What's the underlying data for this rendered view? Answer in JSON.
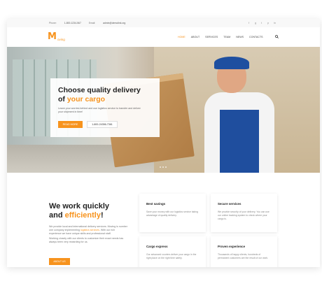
{
  "topbar": {
    "phone_label": "Phone:",
    "phone": "1-800-1234-567",
    "email_label": "Email:",
    "email": "admin@demolink.org",
    "socials": [
      "facebook-icon",
      "google-plus-icon",
      "twitter-icon",
      "pinterest-icon",
      "linkedin-icon"
    ]
  },
  "header": {
    "logo_mark": "M",
    "logo_text": "oving",
    "nav": [
      "HOME",
      "ABOUT",
      "SERVICES",
      "TEAM",
      "NEWS",
      "CONTACTS"
    ],
    "active_nav": "HOME"
  },
  "hero": {
    "title_line1": "Choose quality delivery",
    "title_line2_prefix": "of ",
    "title_line2_accent": "your cargo",
    "text": "Leave your worries behind and use logistics service to transfer and deliver your shipment in time!",
    "button": "READ MORE",
    "phone_button": "1-800-24356-7361"
  },
  "about": {
    "title_line1": "We work quickly",
    "title_line2_prefix": "and ",
    "title_line2_accent": "efficiently",
    "title_line2_suffix": "!",
    "p1_before": "We provide local and international delivery services. Moving is number one company implementing ",
    "p1_link": "logistics services",
    "p1_after": ". With our rich experience we have unique skills and professional staff.",
    "p2": "Working closely with our clients to customize their exact needs has always been very rewarding for us.",
    "button": "ABOUT US"
  },
  "features": [
    {
      "title": "Best savings",
      "text": "Save your money with our logistics service taking advantage of quality delivery."
    },
    {
      "title": "Secure services",
      "text": "We provide security of your delivery. You can use our online tracking system to check where your cargo is."
    },
    {
      "title": "Cargo express",
      "text": "Our advanced couriers deliver your cargo in the right place on the right time safely."
    },
    {
      "title": "Proven experience",
      "text": "Thousands of happy clients, hundreds of permanent customers are the result of our work."
    }
  ],
  "colors": {
    "accent": "#f7931d",
    "text": "#222222"
  }
}
